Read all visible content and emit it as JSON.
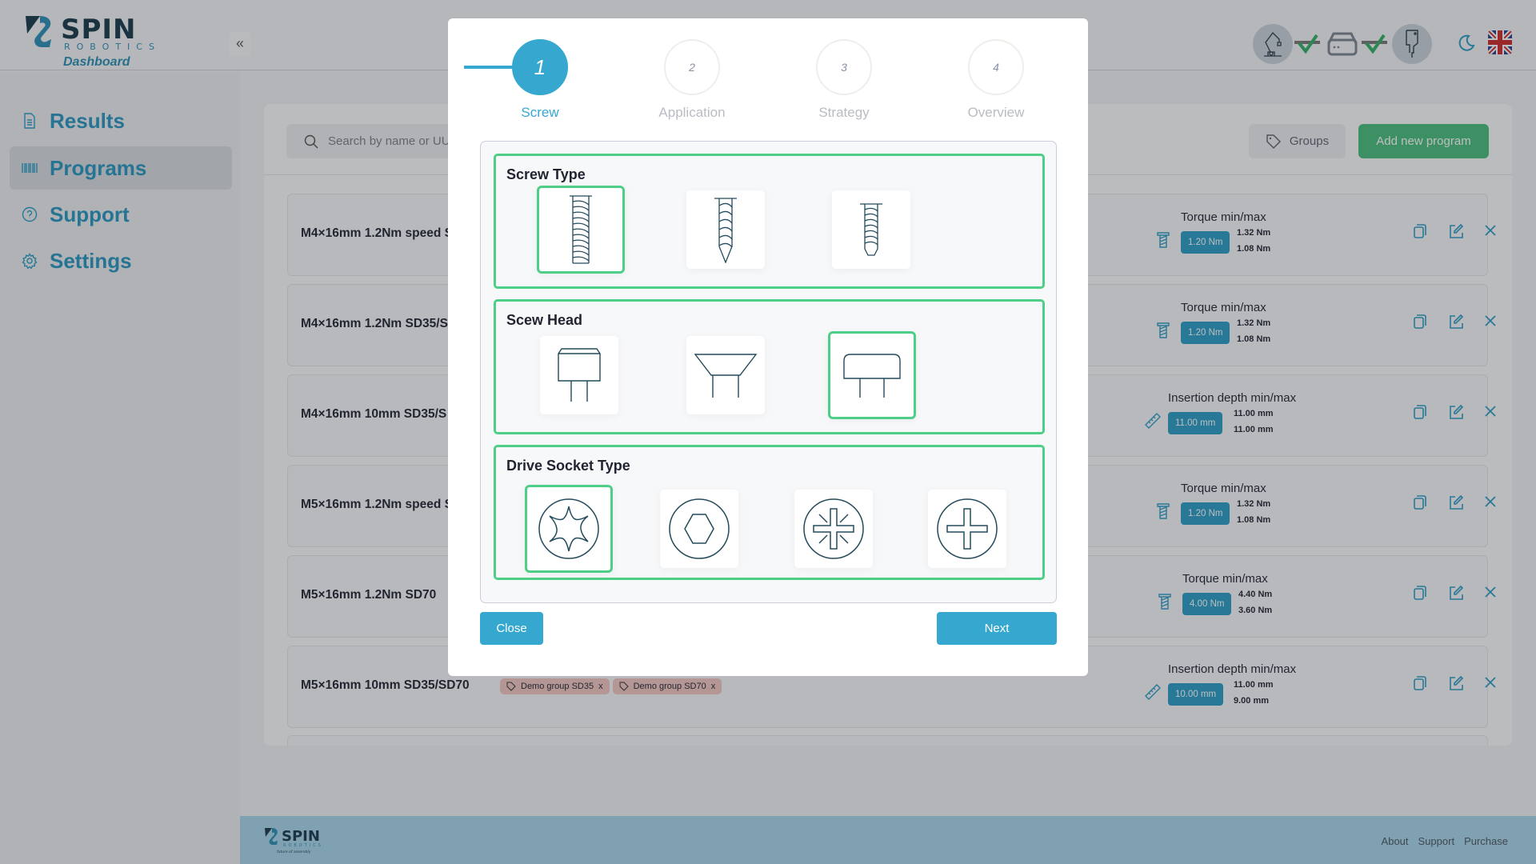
{
  "app": {
    "logo_text": "SPIN ROBOTICS",
    "subtitle": "Dashboard",
    "footer_tagline": "future of assembly"
  },
  "sidebar": {
    "items": [
      {
        "label": "Results",
        "icon": "document-icon"
      },
      {
        "label": "Programs",
        "icon": "barcode-icon",
        "active": true
      },
      {
        "label": "Support",
        "icon": "help-circle-icon"
      },
      {
        "label": "Settings",
        "icon": "gear-icon"
      }
    ]
  },
  "header": {
    "status": [
      "robot-arm-icon",
      "check-icon",
      "controller-icon",
      "check-icon",
      "screwdriver-icon"
    ],
    "theme_icon": "moon-icon",
    "language": "English (UK flag)"
  },
  "toolbar": {
    "search_placeholder": "Search by name or UU",
    "groups_label": "Groups",
    "add_label": "Add new program"
  },
  "programs": [
    {
      "name": "M4×16mm 1.2Nm speed S",
      "metric": "Torque min/max",
      "type": "torque",
      "value": "1.20 Nm",
      "max": "1.32 Nm",
      "min": "1.08 Nm"
    },
    {
      "name": "M4×16mm 1.2Nm SD35/S",
      "metric": "Torque min/max",
      "type": "torque",
      "value": "1.20 Nm",
      "max": "1.32 Nm",
      "min": "1.08 Nm"
    },
    {
      "name": "M4×16mm 10mm SD35/S",
      "metric": "Insertion depth min/max",
      "type": "depth",
      "value": "11.00 mm",
      "max": "11.00 mm",
      "min": "11.00 mm"
    },
    {
      "name": "M5×16mm 1.2Nm speed S",
      "metric": "Torque min/max",
      "type": "torque",
      "value": "1.20 Nm",
      "max": "1.32 Nm",
      "min": "1.08 Nm"
    },
    {
      "name": "M5×16mm 1.2Nm SD70",
      "metric": "Torque min/max",
      "type": "torque",
      "value": "4.00 Nm",
      "max": "4.40 Nm",
      "min": "3.60 Nm"
    },
    {
      "name": "M5×16mm 10mm SD35/SD70",
      "metric": "Insertion depth min/max",
      "type": "depth",
      "value": "10.00 mm",
      "max": "11.00 mm",
      "min": "9.00 mm",
      "tags": [
        "Demo group SD35",
        "Demo group SD70"
      ]
    }
  ],
  "tag_remove": "x",
  "footer": {
    "links": [
      "About",
      "Support",
      "Purchase"
    ]
  },
  "modal": {
    "steps": [
      {
        "num": "1",
        "label": "Screw",
        "active": true
      },
      {
        "num": "2",
        "label": "Application"
      },
      {
        "num": "3",
        "label": "Strategy"
      },
      {
        "num": "4",
        "label": "Overview"
      }
    ],
    "sections": [
      {
        "title": "Screw Type",
        "options": [
          "machine-screw",
          "self-tapping-pointed",
          "thread-forming"
        ],
        "selected": 0
      },
      {
        "title": "Scew Head",
        "options": [
          "cylinder-head",
          "countersunk-head",
          "pan-head"
        ],
        "selected": 2
      },
      {
        "title": "Drive Socket Type",
        "options": [
          "torx",
          "hex",
          "pozidriv",
          "phillips"
        ],
        "selected": 0
      }
    ],
    "close_label": "Close",
    "next_label": "Next"
  },
  "colors": {
    "accent": "#36a8d0",
    "selected": "#4fce87",
    "add_button": "#48bd7a",
    "tag": "#f3c6c1"
  }
}
